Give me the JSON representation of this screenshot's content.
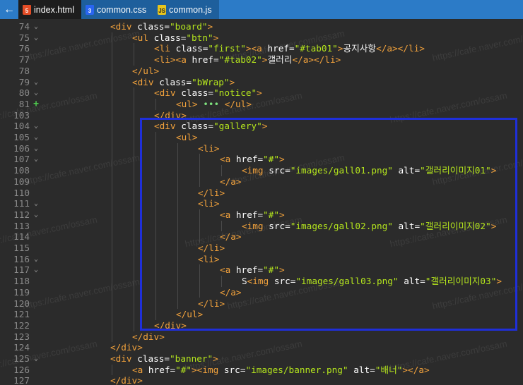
{
  "tabs": [
    {
      "label": "index.html",
      "icon": "html5-icon",
      "active": true
    },
    {
      "label": "common.css",
      "icon": "css3-icon",
      "active": false
    },
    {
      "label": "common.js",
      "icon": "js-icon",
      "active": false
    }
  ],
  "back_icon": "←",
  "watermark": "https://cafe.naver.com/ossam",
  "colors": {
    "tabbar": "#2c7bc7",
    "tag": "#f2a23c",
    "attr": "#ffffff",
    "value": "#b5e61d",
    "highlight": "#1f2fd9"
  },
  "lines": [
    {
      "num": "74",
      "fold": "v",
      "indent": 2,
      "tokens": [
        [
          "t",
          "<div "
        ],
        [
          "a",
          "class"
        ],
        [
          "x",
          "="
        ],
        [
          "v",
          "\"board\""
        ],
        [
          "t",
          ">"
        ]
      ]
    },
    {
      "num": "75",
      "fold": "v",
      "indent": 3,
      "tokens": [
        [
          "t",
          "<ul "
        ],
        [
          "a",
          "class"
        ],
        [
          "x",
          "="
        ],
        [
          "v",
          "\"btn\""
        ],
        [
          "t",
          ">"
        ]
      ]
    },
    {
      "num": "76",
      "fold": "",
      "indent": 4,
      "tokens": [
        [
          "t",
          "<li "
        ],
        [
          "a",
          "class"
        ],
        [
          "x",
          "="
        ],
        [
          "v",
          "\"first\""
        ],
        [
          "t",
          "><a "
        ],
        [
          "a",
          "href"
        ],
        [
          "x",
          "="
        ],
        [
          "v",
          "\"#tab01\""
        ],
        [
          "t",
          ">"
        ],
        [
          "x",
          "공지사항"
        ],
        [
          "t",
          "</a></li>"
        ]
      ]
    },
    {
      "num": "77",
      "fold": "",
      "indent": 4,
      "tokens": [
        [
          "t",
          "<li><a "
        ],
        [
          "a",
          "href"
        ],
        [
          "x",
          "="
        ],
        [
          "v",
          "\"#tab02\""
        ],
        [
          "t",
          ">"
        ],
        [
          "x",
          "갤러리"
        ],
        [
          "t",
          "</a></li>"
        ]
      ]
    },
    {
      "num": "78",
      "fold": "",
      "indent": 3,
      "tokens": [
        [
          "t",
          "</ul>"
        ]
      ]
    },
    {
      "num": "79",
      "fold": "v",
      "indent": 3,
      "tokens": [
        [
          "t",
          "<div "
        ],
        [
          "a",
          "class"
        ],
        [
          "x",
          "="
        ],
        [
          "v",
          "\"bWrap\""
        ],
        [
          "t",
          ">"
        ]
      ]
    },
    {
      "num": "80",
      "fold": "v",
      "indent": 4,
      "tokens": [
        [
          "t",
          "<div "
        ],
        [
          "a",
          "class"
        ],
        [
          "x",
          "="
        ],
        [
          "v",
          "\"notice\""
        ],
        [
          "t",
          ">"
        ]
      ]
    },
    {
      "num": "81",
      "fold": "+",
      "indent": 5,
      "tokens": [
        [
          "t",
          "<ul> "
        ],
        [
          "ell",
          "•••"
        ],
        [
          "t",
          " </ul>"
        ]
      ]
    },
    {
      "num": "103",
      "fold": "",
      "indent": 4,
      "tokens": [
        [
          "t",
          "</div>"
        ]
      ]
    },
    {
      "num": "104",
      "fold": "v",
      "indent": 4,
      "tokens": [
        [
          "t",
          "<div "
        ],
        [
          "a",
          "class"
        ],
        [
          "x",
          "="
        ],
        [
          "v",
          "\"gallery\""
        ],
        [
          "t",
          ">"
        ]
      ]
    },
    {
      "num": "105",
      "fold": "v",
      "indent": 5,
      "tokens": [
        [
          "t",
          "<ul>"
        ]
      ]
    },
    {
      "num": "106",
      "fold": "v",
      "indent": 6,
      "tokens": [
        [
          "t",
          "<li>"
        ]
      ]
    },
    {
      "num": "107",
      "fold": "v",
      "indent": 7,
      "tokens": [
        [
          "t",
          "<a "
        ],
        [
          "a",
          "href"
        ],
        [
          "x",
          "="
        ],
        [
          "v",
          "\"#\""
        ],
        [
          "t",
          ">"
        ]
      ]
    },
    {
      "num": "108",
      "fold": "",
      "indent": 8,
      "tokens": [
        [
          "t",
          "<img "
        ],
        [
          "a",
          "src"
        ],
        [
          "x",
          "="
        ],
        [
          "v",
          "\"images/gall01.png\""
        ],
        [
          "x",
          " "
        ],
        [
          "a",
          "alt"
        ],
        [
          "x",
          "="
        ],
        [
          "v",
          "\"갤러리이미지01\""
        ],
        [
          "t",
          ">"
        ]
      ]
    },
    {
      "num": "109",
      "fold": "",
      "indent": 7,
      "tokens": [
        [
          "t",
          "</a>"
        ]
      ]
    },
    {
      "num": "110",
      "fold": "",
      "indent": 6,
      "tokens": [
        [
          "t",
          "</li>"
        ]
      ]
    },
    {
      "num": "111",
      "fold": "v",
      "indent": 6,
      "tokens": [
        [
          "t",
          "<li>"
        ]
      ]
    },
    {
      "num": "112",
      "fold": "v",
      "indent": 7,
      "tokens": [
        [
          "t",
          "<a "
        ],
        [
          "a",
          "href"
        ],
        [
          "x",
          "="
        ],
        [
          "v",
          "\"#\""
        ],
        [
          "t",
          ">"
        ]
      ]
    },
    {
      "num": "113",
      "fold": "",
      "indent": 8,
      "tokens": [
        [
          "t",
          "<img "
        ],
        [
          "a",
          "src"
        ],
        [
          "x",
          "="
        ],
        [
          "v",
          "\"images/gall02.png\""
        ],
        [
          "x",
          " "
        ],
        [
          "a",
          "alt"
        ],
        [
          "x",
          "="
        ],
        [
          "v",
          "\"갤러리이미지02\""
        ],
        [
          "t",
          ">"
        ]
      ]
    },
    {
      "num": "114",
      "fold": "",
      "indent": 7,
      "tokens": [
        [
          "t",
          "</a>"
        ]
      ]
    },
    {
      "num": "115",
      "fold": "",
      "indent": 6,
      "tokens": [
        [
          "t",
          "</li>"
        ]
      ]
    },
    {
      "num": "116",
      "fold": "v",
      "indent": 6,
      "tokens": [
        [
          "t",
          "<li>"
        ]
      ]
    },
    {
      "num": "117",
      "fold": "v",
      "indent": 7,
      "tokens": [
        [
          "t",
          "<a "
        ],
        [
          "a",
          "href"
        ],
        [
          "x",
          "="
        ],
        [
          "v",
          "\"#\""
        ],
        [
          "t",
          ">"
        ]
      ]
    },
    {
      "num": "118",
      "fold": "",
      "indent": 8,
      "tokens": [
        [
          "x",
          "S"
        ],
        [
          "t",
          "<img "
        ],
        [
          "a",
          "src"
        ],
        [
          "x",
          "="
        ],
        [
          "v",
          "\"images/gall03.png\""
        ],
        [
          "x",
          " "
        ],
        [
          "a",
          "alt"
        ],
        [
          "x",
          "="
        ],
        [
          "v",
          "\"갤러리이미지03\""
        ],
        [
          "t",
          ">"
        ]
      ]
    },
    {
      "num": "119",
      "fold": "",
      "indent": 7,
      "tokens": [
        [
          "t",
          "</a>"
        ]
      ]
    },
    {
      "num": "120",
      "fold": "",
      "indent": 6,
      "tokens": [
        [
          "t",
          "</li>"
        ]
      ]
    },
    {
      "num": "121",
      "fold": "",
      "indent": 5,
      "tokens": [
        [
          "t",
          "</ul>"
        ]
      ]
    },
    {
      "num": "122",
      "fold": "",
      "indent": 4,
      "tokens": [
        [
          "t",
          "</div>"
        ]
      ]
    },
    {
      "num": "123",
      "fold": "",
      "indent": 3,
      "tokens": [
        [
          "t",
          "</div>"
        ]
      ]
    },
    {
      "num": "124",
      "fold": "",
      "indent": 2,
      "tokens": [
        [
          "t",
          "</div>"
        ]
      ]
    },
    {
      "num": "125",
      "fold": "v",
      "indent": 2,
      "tokens": [
        [
          "t",
          "<div "
        ],
        [
          "a",
          "class"
        ],
        [
          "x",
          "="
        ],
        [
          "v",
          "\"banner\""
        ],
        [
          "t",
          ">"
        ]
      ]
    },
    {
      "num": "126",
      "fold": "",
      "indent": 3,
      "tokens": [
        [
          "t",
          "<a "
        ],
        [
          "a",
          "href"
        ],
        [
          "x",
          "="
        ],
        [
          "v",
          "\"#\""
        ],
        [
          "t",
          "><img "
        ],
        [
          "a",
          "src"
        ],
        [
          "x",
          "="
        ],
        [
          "v",
          "\"images/banner.png\""
        ],
        [
          "x",
          " "
        ],
        [
          "a",
          "alt"
        ],
        [
          "x",
          "="
        ],
        [
          "v",
          "\"배너\""
        ],
        [
          "t",
          "></a>"
        ]
      ]
    },
    {
      "num": "127",
      "fold": "",
      "indent": 2,
      "tokens": [
        [
          "t",
          "</div>"
        ]
      ]
    }
  ]
}
